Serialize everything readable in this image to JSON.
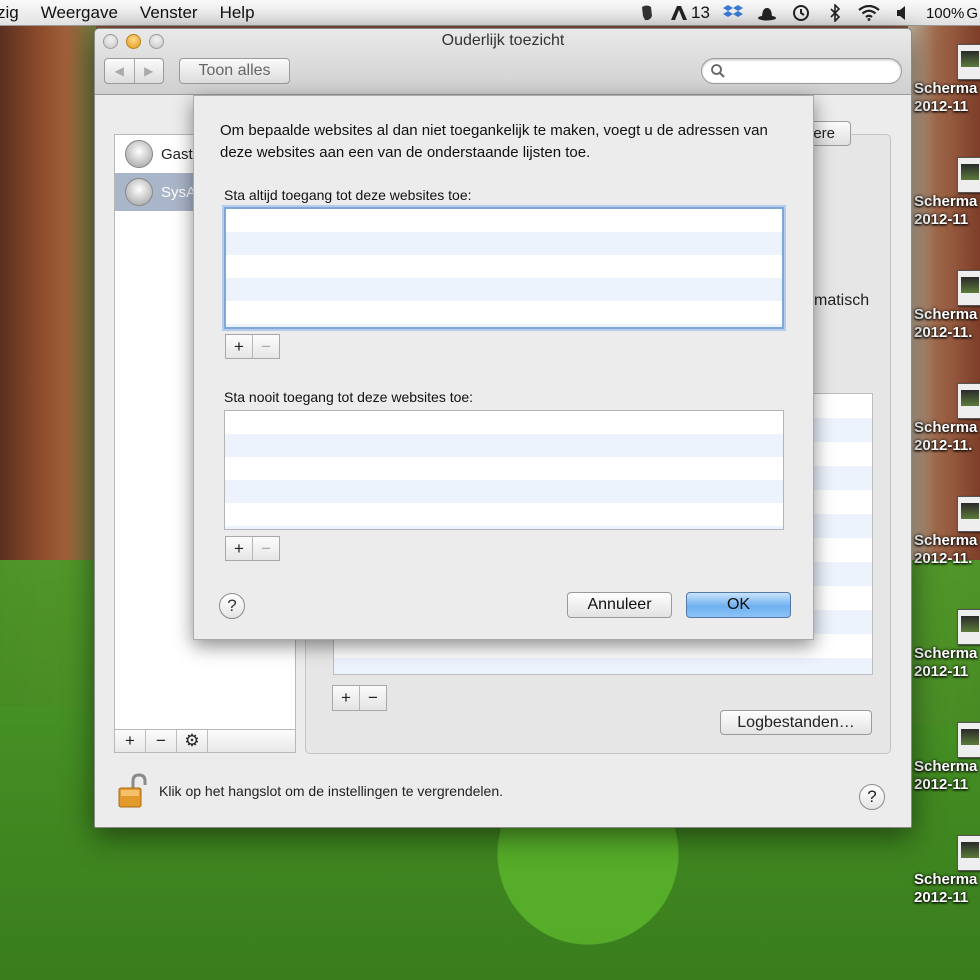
{
  "menubar": {
    "items": [
      "zig",
      "Weergave",
      "Venster",
      "Help"
    ],
    "status": {
      "evernote_icon": "elephant-icon",
      "adobe_count": "13",
      "battery": "100%",
      "battery_suffix": "G"
    }
  },
  "desktop": {
    "icons": [
      {
        "line1": "Scherma",
        "line2": "2012-11"
      },
      {
        "line1": "Scherma",
        "line2": "2012-11"
      },
      {
        "line1": "Scherma",
        "line2": "2012-11."
      },
      {
        "line1": "Scherma",
        "line2": "2012-11."
      },
      {
        "line1": "Scherma",
        "line2": "2012-11."
      },
      {
        "line1": "Scherma",
        "line2": "2012-11"
      },
      {
        "line1": "Scherma",
        "line2": "2012-11"
      },
      {
        "line1": "Scherma",
        "line2": "2012-11"
      }
    ]
  },
  "window": {
    "title": "Ouderlijk toezicht",
    "show_all": "Toon alles",
    "search_placeholder": "",
    "users": [
      "Gast",
      "SysA"
    ],
    "bg_other_button": "Andere",
    "bg_automatic_text": "matisch",
    "log_button": "Logbestanden…",
    "lock_text": "Klik op het hangslot om de instellingen te vergrendelen.",
    "help": "?"
  },
  "sheet": {
    "intro": "Om bepaalde websites al dan niet toegankelijk te maken, voegt u de adressen van deze websites aan een van de onderstaande lijsten toe.",
    "allow_label": "Sta altijd toegang tot deze websites toe:",
    "deny_label": "Sta nooit toegang tot deze websites toe:",
    "plus": "+",
    "minus": "−",
    "help": "?",
    "cancel": "Annuleer",
    "ok": "OK"
  },
  "colors": {
    "default_button": "#6fb0f0",
    "selection": "#a9b5c8"
  }
}
